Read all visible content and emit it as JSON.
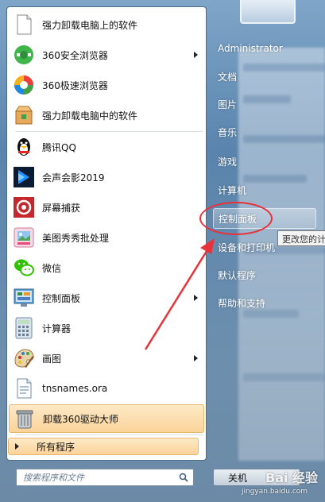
{
  "left_items": [
    {
      "label": "强力卸载电脑上的软件",
      "icon": "document-icon",
      "submenu": false
    },
    {
      "label": "360安全浏览器",
      "icon": "360-browser-icon",
      "submenu": true
    },
    {
      "label": "360极速浏览器",
      "icon": "360-extreme-browser-icon",
      "submenu": false
    },
    {
      "label": "强力卸载电脑中的软件",
      "icon": "uninstall-box-icon",
      "submenu": false
    },
    {
      "label": "腾讯QQ",
      "icon": "qq-penguin-icon",
      "submenu": false
    },
    {
      "label": "会声会影2019",
      "icon": "video-studio-icon",
      "submenu": false
    },
    {
      "label": "屏幕捕获",
      "icon": "screen-capture-icon",
      "submenu": false
    },
    {
      "label": "美图秀秀批处理",
      "icon": "meitu-icon",
      "submenu": false
    },
    {
      "label": "微信",
      "icon": "wechat-icon",
      "submenu": false
    },
    {
      "label": "控制面板",
      "icon": "control-panel-icon",
      "submenu": true
    },
    {
      "label": "计算器",
      "icon": "calculator-icon",
      "submenu": false
    },
    {
      "label": "画图",
      "icon": "paint-icon",
      "submenu": true
    },
    {
      "label": "tnsnames.ora",
      "icon": "file-icon",
      "submenu": false
    },
    {
      "label": "卸载360驱动大师",
      "icon": "trash-can-icon",
      "submenu": false
    }
  ],
  "all_programs": "所有程序",
  "search": {
    "placeholder": "搜索程序和文件"
  },
  "right_items": [
    {
      "label": "Administrator"
    },
    {
      "label": "文档"
    },
    {
      "label": "图片"
    },
    {
      "label": "音乐"
    },
    {
      "label": "游戏"
    },
    {
      "label": "计算机"
    },
    {
      "label": "控制面板"
    },
    {
      "label": "设备和打印机"
    },
    {
      "label": "默认程序"
    },
    {
      "label": "帮助和支持"
    }
  ],
  "tooltip": "更改您的计",
  "shutdown_label": "关机",
  "watermark": {
    "logo": "Bai 经验",
    "url": "jingyan.baidu.com"
  },
  "colors": {
    "highlight": "#fbd39a",
    "annotation_red": "#e8323a"
  }
}
